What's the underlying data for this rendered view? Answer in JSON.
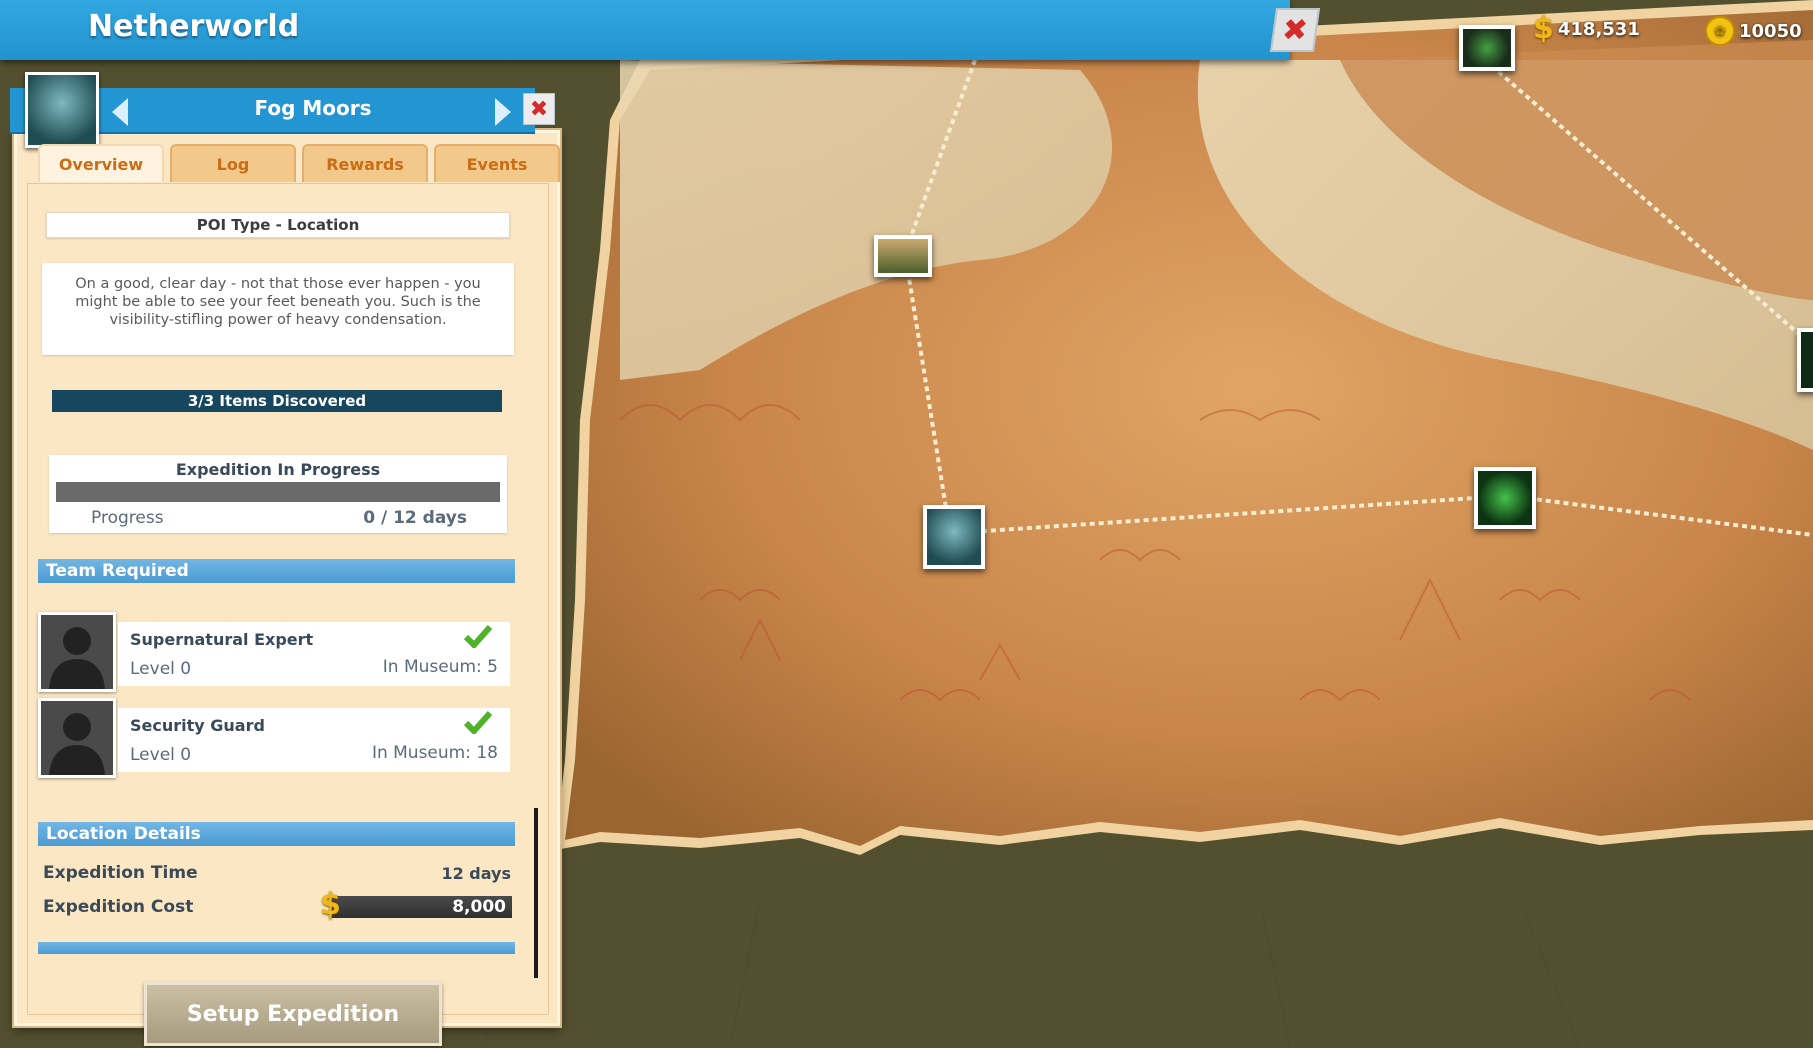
{
  "header": {
    "title": "Netherworld",
    "close_symbol": "✖"
  },
  "currency": {
    "money": "418,531",
    "coins": "10050",
    "money_icon": "dollar-icon",
    "coin_icon": "coin-icon"
  },
  "panel": {
    "location_name": "Fog Moors",
    "close_symbol": "✖",
    "tabs": [
      {
        "label": "Overview",
        "active": true
      },
      {
        "label": "Log",
        "active": false
      },
      {
        "label": "Rewards",
        "active": false
      },
      {
        "label": "Events",
        "active": false
      }
    ],
    "poi_type": "POI Type - Location",
    "description": "On a good, clear day - not that those ever happen - you might be able to see your feet beneath you. Such is the visibility-stifling power of heavy condensation.",
    "items_discovered": "3/3 Items Discovered",
    "expedition": {
      "title": "Expedition In Progress",
      "progress_label": "Progress",
      "progress_value": "0 / 12 days",
      "progress_fraction": 0
    },
    "team_section": "Team Required",
    "team": [
      {
        "role": "Supernatural Expert",
        "level": "Level 0",
        "museum": "In Museum: 5",
        "met": true
      },
      {
        "role": "Security Guard",
        "level": "Level 0",
        "museum": "In Museum: 18",
        "met": true
      }
    ],
    "details_section": "Location Details",
    "details": {
      "time_label": "Expedition Time",
      "time_value": "12 days",
      "cost_label": "Expedition Cost",
      "cost_value": "8,000"
    },
    "setup_button": "Setup Expedition"
  },
  "colors": {
    "header_blue": "#2395d2",
    "parchment": "#fbe7c4",
    "tab_text": "#c96d16",
    "check_green": "#4fb32a",
    "close_red": "#d42a2a"
  }
}
